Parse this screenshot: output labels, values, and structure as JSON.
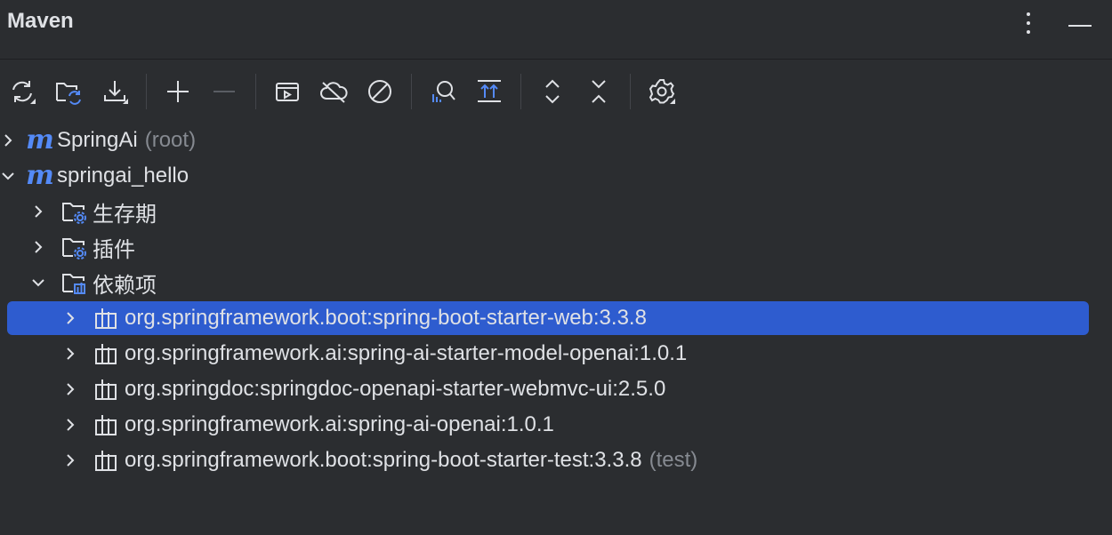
{
  "header": {
    "title": "Maven",
    "more_icon": "more-vertical-icon",
    "hide_icon": "minimize-icon"
  },
  "toolbar": {
    "icons": [
      "reload-all-icon",
      "reload-project-icon",
      "download-icon",
      "add-icon",
      "remove-icon",
      "run-config-icon",
      "offline-mode-icon",
      "skip-tests-icon",
      "analyze-dependencies-icon",
      "show-dependencies-icon",
      "expand-all-icon",
      "collapse-all-icon",
      "settings-icon"
    ]
  },
  "tree": {
    "root": {
      "label": "SpringAi",
      "suffix": "(root)"
    },
    "module": {
      "label": "springai_hello"
    },
    "folders": [
      {
        "label": "生存期"
      },
      {
        "label": "插件"
      },
      {
        "label": "依赖项"
      }
    ],
    "dependencies": [
      {
        "label": "org.springframework.boot:spring-boot-starter-web:3.3.8",
        "suffix": ""
      },
      {
        "label": "org.springframework.ai:spring-ai-starter-model-openai:1.0.1",
        "suffix": ""
      },
      {
        "label": "org.springdoc:springdoc-openapi-starter-webmvc-ui:2.5.0",
        "suffix": ""
      },
      {
        "label": "org.springframework.ai:spring-ai-openai:1.0.1",
        "suffix": ""
      },
      {
        "label": "org.springframework.boot:spring-boot-starter-test:3.3.8",
        "suffix": "(test)"
      }
    ]
  },
  "colors": {
    "background": "#2b2d30",
    "selection": "#2e5ccf",
    "accent": "#548af7",
    "text": "#dfe1e5",
    "muted": "#868a91"
  }
}
